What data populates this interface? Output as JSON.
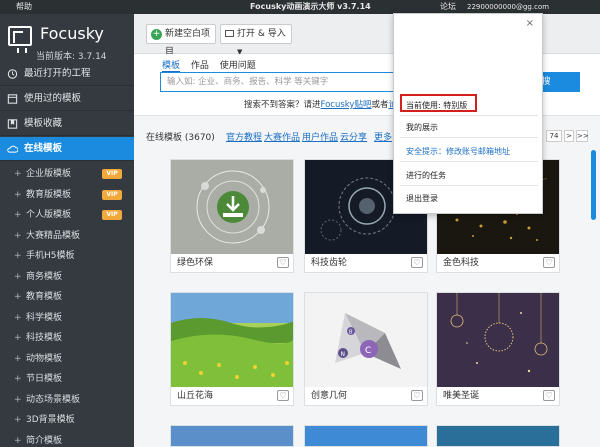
{
  "titlebar": {
    "help": "帮助",
    "title": "Focusky动画演示大师 v3.7.14",
    "forum": "论坛",
    "email": "22900000000@gg.com"
  },
  "sidebar": {
    "brand": "Focusky",
    "version": "当前版本: 3.7.14",
    "nav": [
      {
        "label": "最近打开的工程",
        "icon": "clock-icon"
      },
      {
        "label": "使用过的模板",
        "icon": "template-icon"
      },
      {
        "label": "模板收藏",
        "icon": "bookmark-icon"
      },
      {
        "label": "在线模板",
        "icon": "cloud-icon"
      }
    ],
    "sub": [
      {
        "label": "企业版模板",
        "vip": "VIP"
      },
      {
        "label": "教育版模板",
        "vip": "VIP"
      },
      {
        "label": "个人版模板",
        "vip": "VIP"
      },
      {
        "label": "大赛精品模板"
      },
      {
        "label": "手机H5模板"
      },
      {
        "label": "商务模板"
      },
      {
        "label": "教育模板"
      },
      {
        "label": "科学模板"
      },
      {
        "label": "科技模板"
      },
      {
        "label": "动物模板"
      },
      {
        "label": "节日模板"
      },
      {
        "label": "动态场景模板"
      },
      {
        "label": "3D背景模板"
      },
      {
        "label": "简介模板"
      }
    ]
  },
  "toolbar": {
    "new_label": "新建空白项目",
    "open_label": "打开 & 导入"
  },
  "search": {
    "tabs": [
      "模板",
      "作品",
      "使用问题"
    ],
    "placeholder": "输入如: 企业、商务、报告、科学 等关键字",
    "button": "搜",
    "hint_prefix": "搜索不到答案？请进",
    "hint_link": "Focusky贴吧",
    "hint_mid": "或者",
    "hint_link2": "论坛"
  },
  "filter": {
    "count": "在线模板 (3670)",
    "links": [
      "官方教程",
      "大赛作品",
      "用户作品",
      "云分享",
      "更多"
    ],
    "pages": [
      "74",
      ">",
      ">>"
    ]
  },
  "cards": [
    {
      "label": "绿色环保",
      "heart": "♡"
    },
    {
      "label": "科技齿轮",
      "heart": "♡"
    },
    {
      "label": "金色科技",
      "heart": "♡"
    },
    {
      "label": "山丘花海",
      "heart": "♡"
    },
    {
      "label": "创意几何",
      "heart": "♡"
    },
    {
      "label": "唯美圣诞",
      "heart": "♡"
    }
  ],
  "dropdown": {
    "close": "×",
    "current": "当前使用: 特别版",
    "show": "我的展示",
    "security": "安全提示：修改账号邮箱地址",
    "tasks": "进行的任务",
    "logout": "退出登录"
  },
  "colors": {
    "sidebar": "#343a3f",
    "accent": "#1b8be0",
    "highlight": "#d41f1f"
  }
}
